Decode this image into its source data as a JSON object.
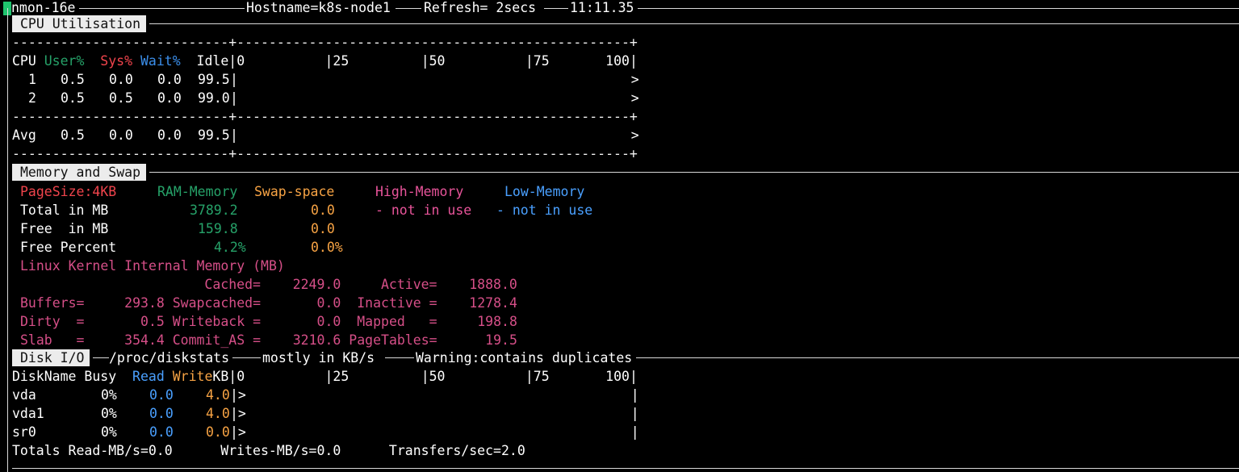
{
  "header": {
    "program": "nmon-16e",
    "hostname": "Hostname=k8s-node1",
    "refresh": "Refresh= 2secs",
    "time": "11:11.35"
  },
  "cpu": {
    "section_title": "CPU Utilisation",
    "dash_line": "---------------------------+-------------------------------------------------+",
    "columns": {
      "cpu": "CPU",
      "user": "User%",
      "sys": "Sys%",
      "wait": "Wait%",
      "idle": "Idle",
      "scale": "|0          |25         |50          |75       100|"
    },
    "rows": [
      {
        "id": "1",
        "user": "0.5",
        "sys": "0.0",
        "wait": "0.0",
        "idle": "99.5",
        "bar": "|                                                 >"
      },
      {
        "id": "2",
        "user": "0.5",
        "sys": "0.5",
        "wait": "0.0",
        "idle": "99.0",
        "bar": "|                                                 >"
      }
    ],
    "avg": {
      "label": "Avg",
      "user": "0.5",
      "sys": "0.0",
      "wait": "0.0",
      "idle": "99.5",
      "bar": "|                                                 >"
    }
  },
  "memory": {
    "section_title": "Memory and Swap",
    "pagesize": "PageSize:4KB",
    "ram_header": "RAM-Memory",
    "swap_header": "Swap-space",
    "high_header": "High-Memory",
    "low_header": "Low-Memory",
    "total_label": "Total in MB",
    "total_ram": "3789.2",
    "total_swap": "0.0",
    "high_status": "- not in use",
    "low_status": "- not in use",
    "free_label": "Free  in MB",
    "free_ram": "159.8",
    "free_swap": "0.0",
    "pct_label": "Free Percent",
    "pct_ram": "4.2%",
    "pct_swap": "0.0%",
    "kernel_title": "Linux Kernel Internal Memory (MB)",
    "kernel_lines": [
      "                        Cached=    2249.0     Active=    1888.0",
      "Buffers=     293.8 Swapcached=       0.0  Inactive =    1278.4",
      "Dirty  =       0.5 Writeback =       0.0  Mapped   =     198.8",
      "Slab   =     354.4 Commit_AS =    3210.6 PageTables=      19.5"
    ]
  },
  "disk": {
    "section_title": "Disk I/O",
    "source": "/proc/diskstats",
    "units": "mostly in KB/s",
    "warning": "Warning:contains duplicates",
    "columns": {
      "name": "DiskName",
      "busy": "Busy",
      "read": "Read",
      "write": "Write",
      "kb": "KB",
      "scale": "|0          |25         |50          |75       100|"
    },
    "rows": [
      {
        "name": "vda",
        "busy": "0%",
        "read": "0.0",
        "write": "4.0",
        "bar": "|>                                                |"
      },
      {
        "name": "vda1",
        "busy": "0%",
        "read": "0.0",
        "write": "4.0",
        "bar": "|>                                                |"
      },
      {
        "name": "sr0",
        "busy": "0%",
        "read": "0.0",
        "write": "0.0",
        "bar": "|>                                                |"
      }
    ],
    "totals": "Totals Read-MB/s=0.0      Writes-MB/s=0.0      Transfers/sec=2.0"
  }
}
